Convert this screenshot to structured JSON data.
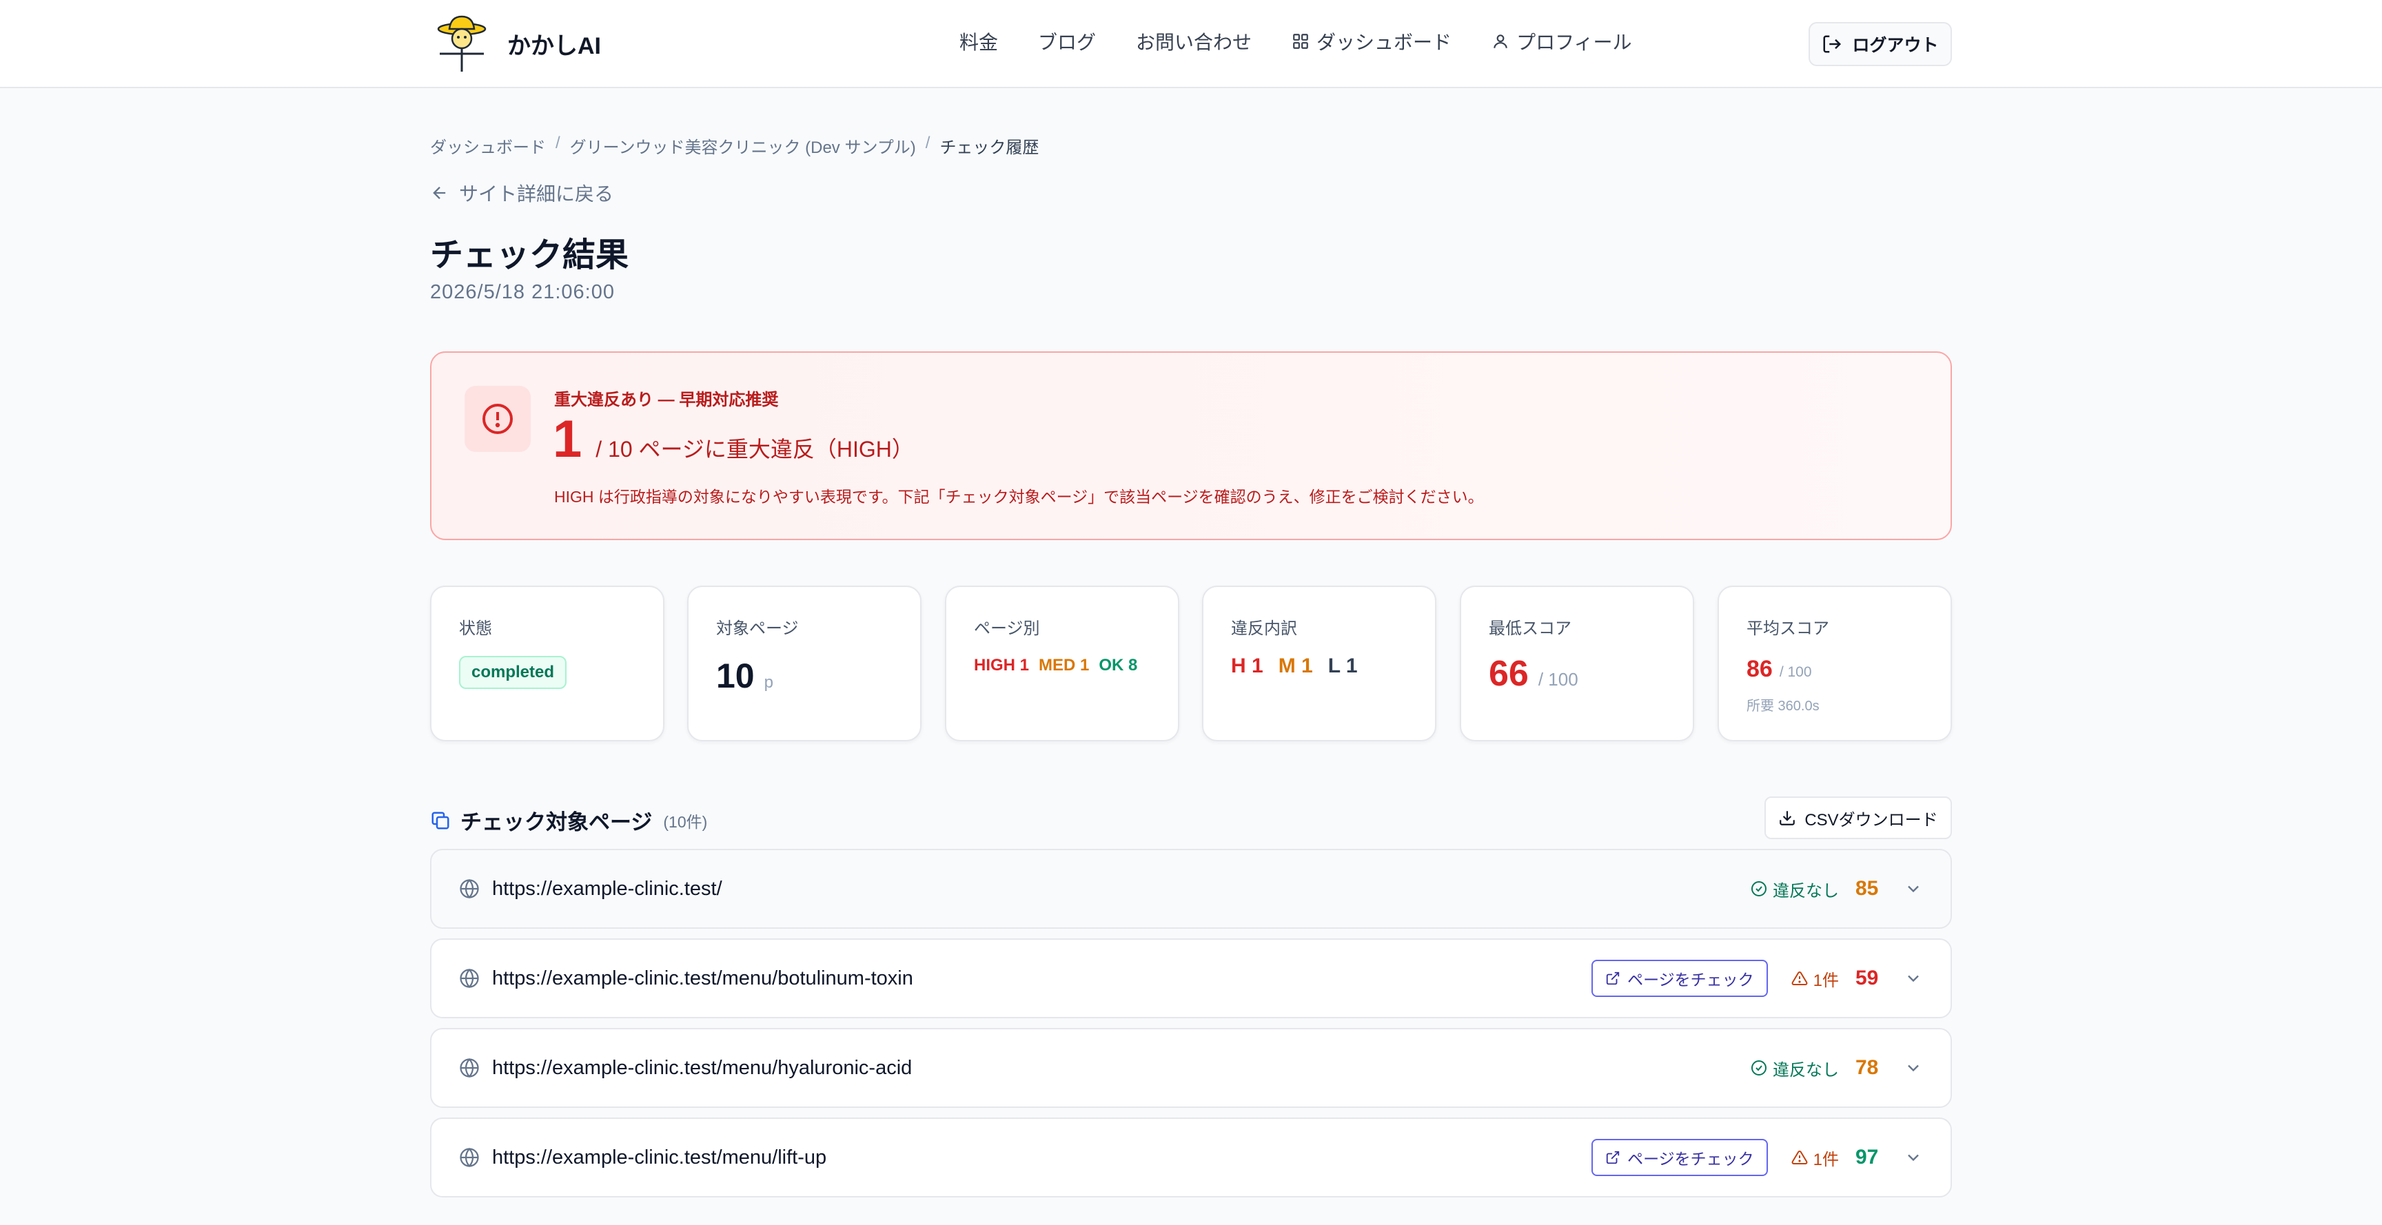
{
  "app": {
    "name": "かかしAI"
  },
  "nav": {
    "pricing": "料金",
    "blog": "ブログ",
    "contact": "お問い合わせ",
    "dashboard": "ダッシュボード",
    "profile": "プロフィール",
    "logout": "ログアウト"
  },
  "breadcrumb": {
    "items": [
      "ダッシュボード",
      "グリーンウッド美容クリニック (Dev サンプル)",
      "チェック履歴"
    ],
    "separator": "/"
  },
  "back_link": "サイト詳細に戻る",
  "page": {
    "title": "チェック結果",
    "date": "2026/5/18 21:06:00"
  },
  "alert": {
    "heading": "重大違反あり — 早期対応推奨",
    "count": "1",
    "count_suffix": "/ 10 ページに重大違反（HIGH）",
    "note": "HIGH は行政指導の対象になりやすい表現です。下記「チェック対象ページ」で該当ページを確認のうえ、修正をご検討ください。"
  },
  "stats": {
    "status": {
      "label": "状態",
      "value": "completed"
    },
    "pages": {
      "label": "対象ページ",
      "value": "10",
      "unit": "p"
    },
    "by_page": {
      "label": "ページ別",
      "high": "HIGH 1",
      "med": "MED 1",
      "ok": "OK 8"
    },
    "breakdown": {
      "label": "違反内訳",
      "h": "H 1",
      "m": "M 1",
      "l": "L 1"
    },
    "min_score": {
      "label": "最低スコア",
      "value": "66",
      "max": "/ 100"
    },
    "avg_score": {
      "label": "平均スコア",
      "value": "86",
      "max": "/ 100",
      "duration": "所要 360.0s"
    }
  },
  "section": {
    "title": "チェック対象ページ",
    "count": "(10件)",
    "csv_button": "CSVダウンロード"
  },
  "rows": [
    {
      "url": "https://example-clinic.test/",
      "has_check_button": false,
      "status": "違反なし",
      "status_type": "ok",
      "score": "85",
      "score_color": "#d97706"
    },
    {
      "url": "https://example-clinic.test/menu/botulinum-toxin",
      "has_check_button": true,
      "status": "1件",
      "status_type": "warn",
      "score": "59",
      "score_color": "#dc2626"
    },
    {
      "url": "https://example-clinic.test/menu/hyaluronic-acid",
      "has_check_button": false,
      "status": "違反なし",
      "status_type": "ok",
      "score": "78",
      "score_color": "#d97706"
    },
    {
      "url": "https://example-clinic.test/menu/lift-up",
      "has_check_button": true,
      "status": "1件",
      "status_type": "warn",
      "score": "97",
      "score_color": "#059669"
    }
  ],
  "check_button_label": "ページをチェック",
  "colors": {
    "high": "#dc2626",
    "med": "#d97706",
    "ok": "#059669",
    "low": "#334155",
    "accent": "#4f46e5"
  }
}
